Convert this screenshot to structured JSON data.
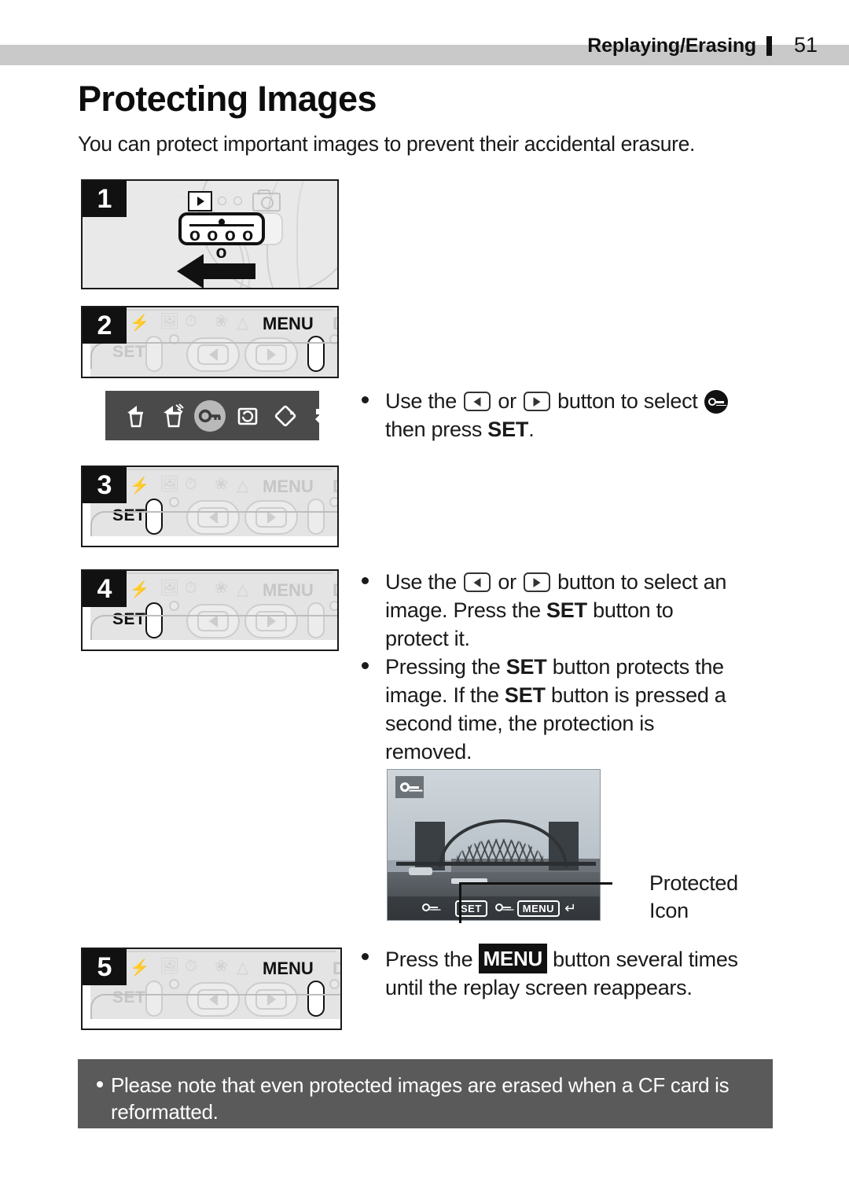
{
  "header": {
    "section": "Replaying/Erasing",
    "page_number": "51"
  },
  "title": "Protecting Images",
  "intro": "You can protect important images to prevent their accidental erasure.",
  "steps": [
    {
      "number": "1",
      "caption": ""
    },
    {
      "number": "2",
      "caption": ""
    },
    {
      "number": "3",
      "caption": ""
    },
    {
      "number": "4",
      "caption": ""
    },
    {
      "number": "5",
      "caption": ""
    }
  ],
  "camera_labels": {
    "set": "SET",
    "menu": "MENU",
    "disp": "DISP"
  },
  "menu_strip": {
    "items": [
      {
        "icon": "erase-single-icon"
      },
      {
        "icon": "erase-all-icon"
      },
      {
        "icon": "protect-key-icon"
      },
      {
        "icon": "slideshow-icon"
      },
      {
        "icon": "rotate-icon"
      },
      {
        "icon": "return-icon"
      }
    ],
    "selected_index": 2
  },
  "instructions": [
    {
      "id": "select-protect",
      "parts": [
        {
          "type": "text",
          "value": "Use the "
        },
        {
          "type": "icon",
          "value": "left-button-icon"
        },
        {
          "type": "text",
          "value": " or "
        },
        {
          "type": "icon",
          "value": "right-button-icon"
        },
        {
          "type": "text",
          "value": " button to select "
        },
        {
          "type": "icon",
          "value": "protect-key-icon"
        },
        {
          "type": "text",
          "value": " then press "
        },
        {
          "type": "bold",
          "value": "SET"
        },
        {
          "type": "text",
          "value": "."
        }
      ],
      "plain": "Use the ◁ or ▷ button to select 🔑 then press SET."
    },
    {
      "id": "select-image",
      "plain": "Use the ◁ or ▷ button to select an image. Press the SET button to protect it."
    },
    {
      "id": "toggle-protection",
      "plain": "Pressing the SET button protects the image. If the SET button is pressed a second time, the protection is removed."
    },
    {
      "id": "exit-menu",
      "plain": "Press the MENU button several times until the replay screen reappears."
    }
  ],
  "lcd": {
    "protected_icon": "protect-key-icon",
    "hud": {
      "set_label": "SET",
      "menu_label": "MENU",
      "key_icon": "protect-key-icon",
      "return_icon": "return-arrow-icon"
    }
  },
  "callout": {
    "line1": "Protected",
    "line2": "Icon"
  },
  "note": "Please note that even protected images are erased when a CF card is reformatted.",
  "colors": {
    "header_band": "#c9c9c9",
    "step_badge": "#111111",
    "menu_strip": "#4a4a4a",
    "note_box": "#5a5a5a",
    "text": "#1a1a1a"
  }
}
